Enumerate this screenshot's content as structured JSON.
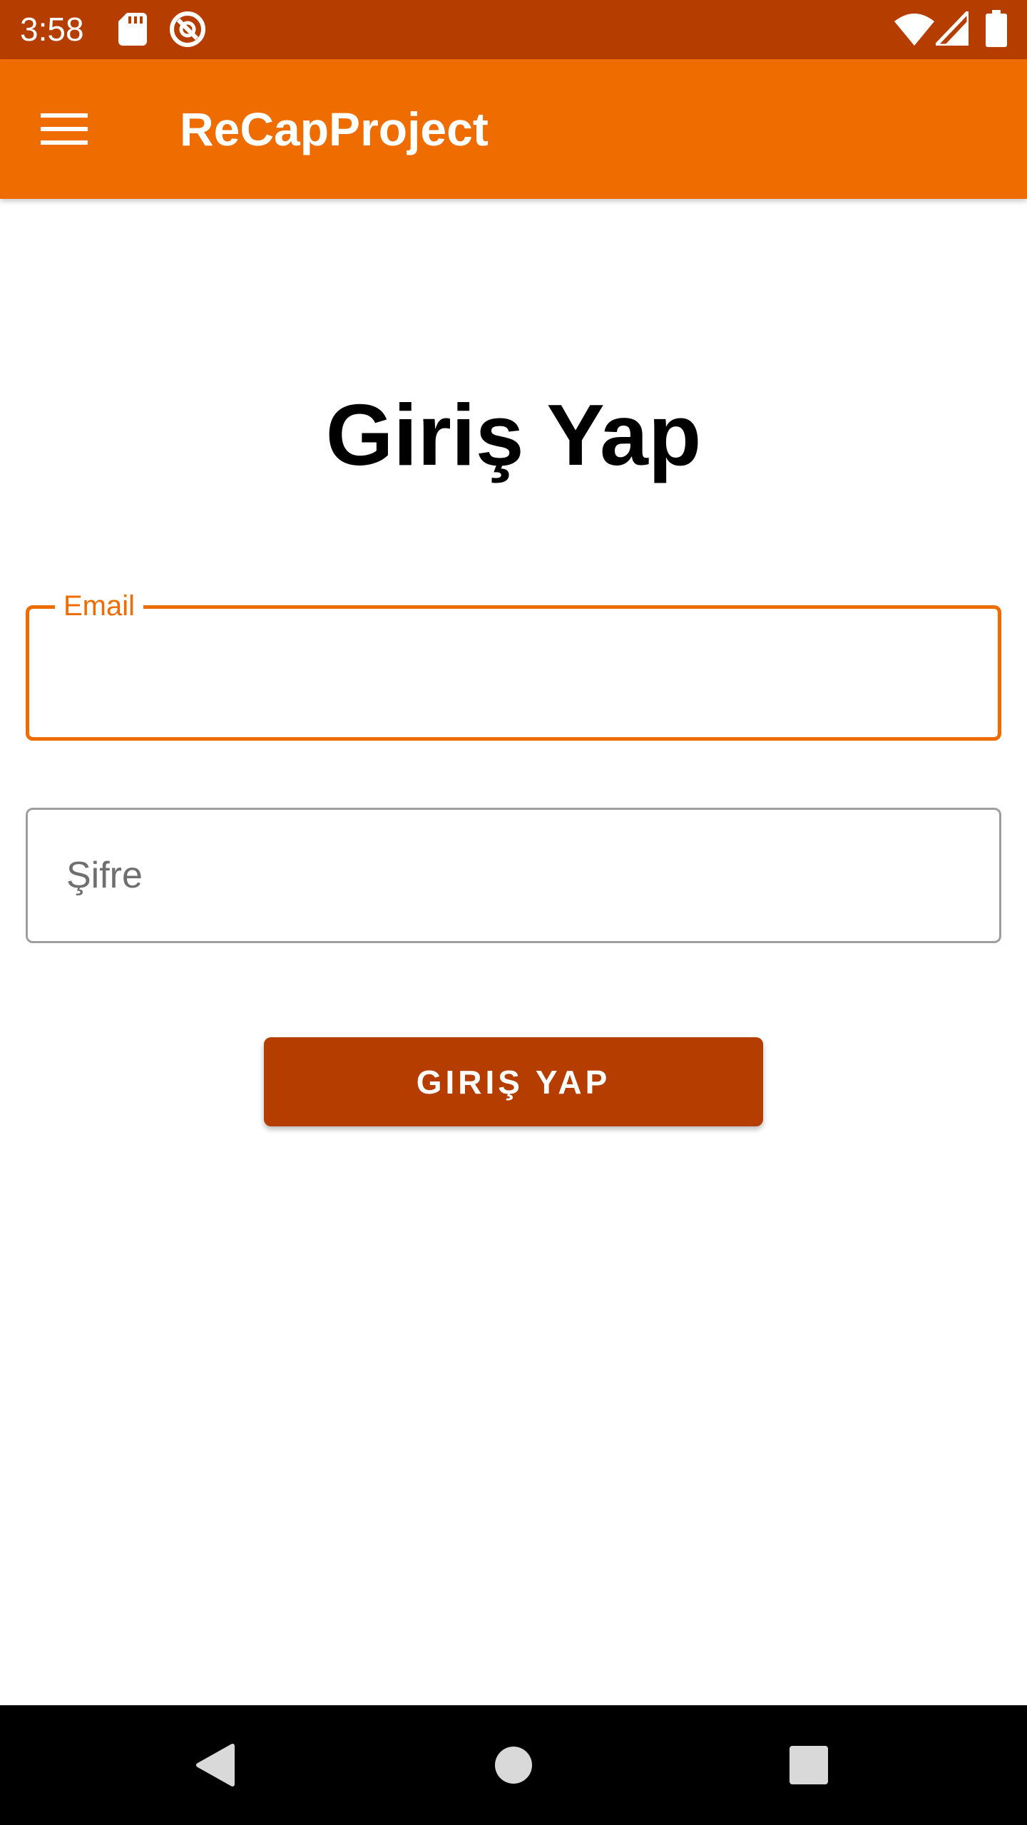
{
  "status_bar": {
    "time": "3:58",
    "icons": [
      "sd-card-icon",
      "qr-sync-icon",
      "wifi-icon",
      "cell-signal-icon",
      "battery-icon"
    ],
    "background": "#b53d00"
  },
  "app_bar": {
    "menu_icon": "hamburger-menu-icon",
    "title": "ReCapProject",
    "background": "#ef6c00"
  },
  "login": {
    "heading": "Giriş Yap",
    "email_label": "Email",
    "email_value": "",
    "password_placeholder": "Şifre",
    "password_value": "",
    "submit_label": "GIRIŞ YAP",
    "accent_color": "#ef6c00",
    "button_color": "#b53d00"
  },
  "nav_bar": {
    "icons": [
      "back-icon",
      "home-icon",
      "recents-icon"
    ]
  }
}
